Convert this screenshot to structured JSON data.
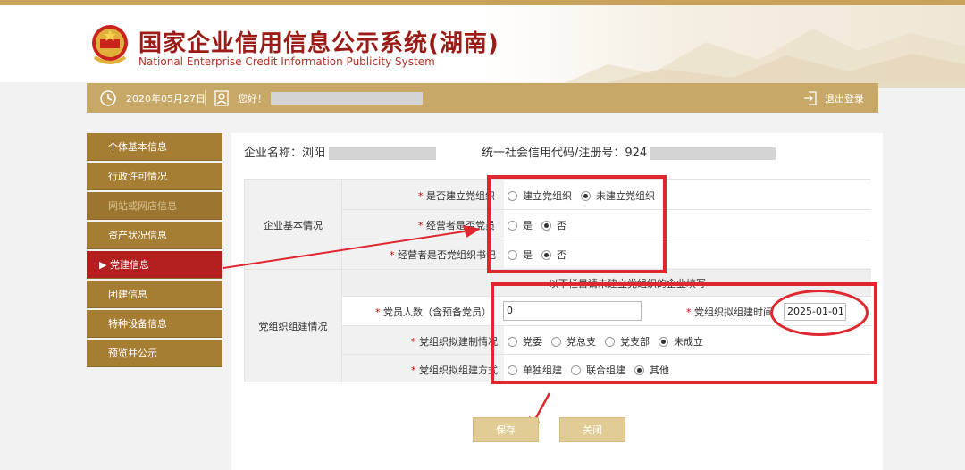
{
  "header": {
    "title_cn": "国家企业信用信息公示系统(湖南)",
    "title_en": "National Enterprise Credit Information Publicity System"
  },
  "topbar": {
    "date": "2020年05月27日",
    "greeting": "您好！",
    "logout": "退出登录"
  },
  "sidebar": {
    "items": [
      {
        "label": "个体基本信息"
      },
      {
        "label": "行政许可情况"
      },
      {
        "label": "网站或网店信息"
      },
      {
        "label": "资产状况信息"
      },
      {
        "label": "▶ 党建信息"
      },
      {
        "label": "团建信息"
      },
      {
        "label": "特种设备信息"
      },
      {
        "label": "预览并公示"
      }
    ]
  },
  "company": {
    "name_label": "企业名称：浏阳",
    "credit_label": "统一社会信用代码/注册号：924"
  },
  "form": {
    "section1": "企业基本情况",
    "section2": "党组织组建情况",
    "q1": "是否建立党组织",
    "q1_options": [
      "建立党组织",
      "未建立党组织"
    ],
    "q2": "经营者是否党员",
    "q2_options": [
      "是",
      "否"
    ],
    "q3": "经营者是否党组织书记",
    "q3_options": [
      "是",
      "否"
    ],
    "note": "以下栏目请未建立党组织的企业填写",
    "q4": "党员人数（含预备党员）",
    "q4_value": "0",
    "q5": "党组织拟组建时间",
    "q5_value": "2025-01-01",
    "q6": "党组织拟建制情况",
    "q6_options": [
      "党委",
      "党总支",
      "党支部",
      "未成立"
    ],
    "q7": "党组织拟组建方式",
    "q7_options": [
      "单独组建",
      "联合组建",
      "其他"
    ]
  },
  "buttons": {
    "save": "保存",
    "close": "关闭"
  }
}
